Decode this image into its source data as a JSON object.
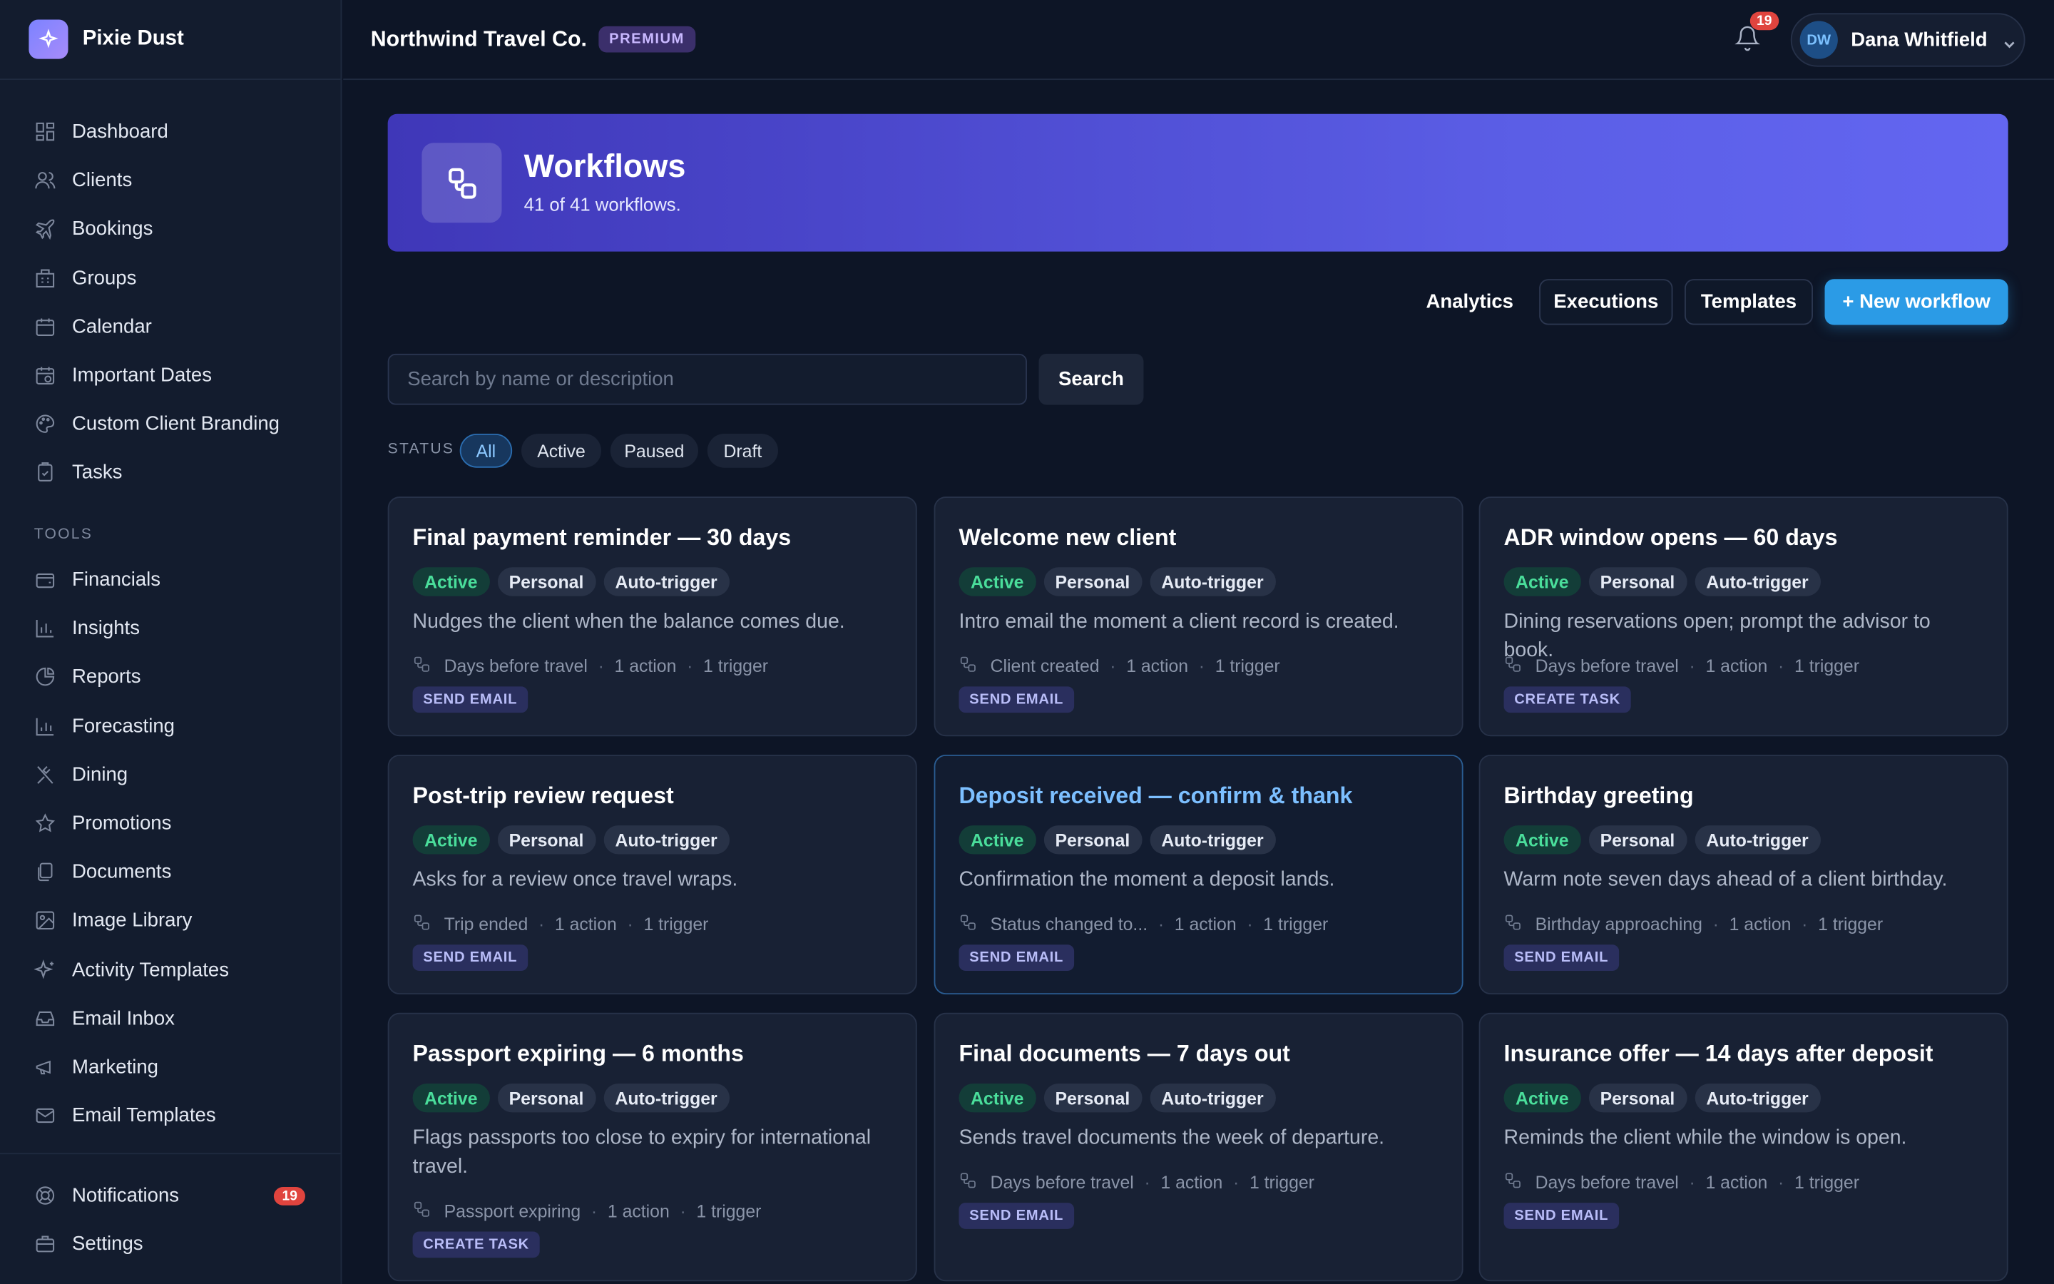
{
  "brand": {
    "name": "Pixie Dust"
  },
  "sidebar": {
    "items": [
      {
        "label": "Dashboard",
        "icon": "grid-icon"
      },
      {
        "label": "Clients",
        "icon": "users-icon"
      },
      {
        "label": "Bookings",
        "icon": "plane-icon"
      },
      {
        "label": "Groups",
        "icon": "building-icon"
      },
      {
        "label": "Calendar",
        "icon": "calendar-icon"
      },
      {
        "label": "Important Dates",
        "icon": "calendar-clock-icon"
      },
      {
        "label": "Custom Client Branding",
        "icon": "palette-icon"
      },
      {
        "label": "Tasks",
        "icon": "clipboard-check-icon"
      }
    ],
    "tools_heading": "TOOLS",
    "tools": [
      {
        "label": "Financials",
        "icon": "wallet-icon"
      },
      {
        "label": "Insights",
        "icon": "bar-chart-icon"
      },
      {
        "label": "Reports",
        "icon": "pie-chart-icon"
      },
      {
        "label": "Forecasting",
        "icon": "bar-chart-icon"
      },
      {
        "label": "Dining",
        "icon": "utensils-icon"
      },
      {
        "label": "Promotions",
        "icon": "star-icon"
      },
      {
        "label": "Documents",
        "icon": "files-icon"
      },
      {
        "label": "Image Library",
        "icon": "image-icon"
      },
      {
        "label": "Activity Templates",
        "icon": "sparkles-icon"
      },
      {
        "label": "Email Inbox",
        "icon": "inbox-icon"
      },
      {
        "label": "Marketing",
        "icon": "megaphone-icon"
      },
      {
        "label": "Email Templates",
        "icon": "mail-icon"
      }
    ],
    "bottom": [
      {
        "label": "Notifications",
        "icon": "lifebuoy-icon",
        "badge": "19"
      },
      {
        "label": "Settings",
        "icon": "briefcase-icon"
      }
    ]
  },
  "topbar": {
    "org_name": "Northwind Travel Co.",
    "plan_badge": "PREMIUM",
    "notification_count": "19",
    "user_initials": "DW",
    "user_name": "Dana Whitfield"
  },
  "hero": {
    "title": "Workflows",
    "subtitle": "41 of 41 workflows."
  },
  "toolbar": {
    "analytics": "Analytics",
    "executions": "Executions",
    "templates": "Templates",
    "new_workflow": "+ New workflow"
  },
  "search": {
    "placeholder": "Search by name or description",
    "value": "",
    "button": "Search"
  },
  "filters": {
    "label": "STATUS",
    "options": [
      "All",
      "Active",
      "Paused",
      "Draft"
    ],
    "selected": "All"
  },
  "colors": {
    "accent": "#2b9be6",
    "active_status": "#4ade9b",
    "badge": "#e0443e",
    "hero_start": "#3f37b8",
    "hero_end": "#6366f1"
  },
  "workflows": [
    {
      "title": "Final payment reminder — 30 days",
      "status": "Active",
      "scope": "Personal",
      "mode": "Auto-trigger",
      "description": "Nudges the client when the balance comes due.",
      "trigger": "Days before travel",
      "actions": "1 action",
      "triggers": "1 trigger",
      "action_type": "SEND EMAIL"
    },
    {
      "title": "Welcome new client",
      "status": "Active",
      "scope": "Personal",
      "mode": "Auto-trigger",
      "description": "Intro email the moment a client record is created.",
      "trigger": "Client created",
      "actions": "1 action",
      "triggers": "1 trigger",
      "action_type": "SEND EMAIL"
    },
    {
      "title": "ADR window opens — 60 days",
      "status": "Active",
      "scope": "Personal",
      "mode": "Auto-trigger",
      "description": "Dining reservations open; prompt the advisor to book.",
      "trigger": "Days before travel",
      "actions": "1 action",
      "triggers": "1 trigger",
      "action_type": "CREATE TASK"
    },
    {
      "title": "Post-trip review request",
      "status": "Active",
      "scope": "Personal",
      "mode": "Auto-trigger",
      "description": "Asks for a review once travel wraps.",
      "trigger": "Trip ended",
      "actions": "1 action",
      "triggers": "1 trigger",
      "action_type": "SEND EMAIL"
    },
    {
      "title": "Deposit received — confirm & thank",
      "status": "Active",
      "scope": "Personal",
      "mode": "Auto-trigger",
      "description": "Confirmation the moment a deposit lands.",
      "trigger": "Status changed to...",
      "actions": "1 action",
      "triggers": "1 trigger",
      "action_type": "SEND EMAIL"
    },
    {
      "title": "Birthday greeting",
      "status": "Active",
      "scope": "Personal",
      "mode": "Auto-trigger",
      "description": "Warm note seven days ahead of a client birthday.",
      "trigger": "Birthday approaching",
      "actions": "1 action",
      "triggers": "1 trigger",
      "action_type": "SEND EMAIL"
    },
    {
      "title": "Passport expiring — 6 months",
      "status": "Active",
      "scope": "Personal",
      "mode": "Auto-trigger",
      "description": "Flags passports too close to expiry for international travel.",
      "trigger": "Passport expiring",
      "actions": "1 action",
      "triggers": "1 trigger",
      "action_type": "CREATE TASK"
    },
    {
      "title": "Final documents — 7 days out",
      "status": "Active",
      "scope": "Personal",
      "mode": "Auto-trigger",
      "description": "Sends travel documents the week of departure.",
      "trigger": "Days before travel",
      "actions": "1 action",
      "triggers": "1 trigger",
      "action_type": "SEND EMAIL"
    },
    {
      "title": "Insurance offer — 14 days after deposit",
      "status": "Active",
      "scope": "Personal",
      "mode": "Auto-trigger",
      "description": "Reminds the client while the window is open.",
      "trigger": "Days before travel",
      "actions": "1 action",
      "triggers": "1 trigger",
      "action_type": "SEND EMAIL"
    }
  ]
}
